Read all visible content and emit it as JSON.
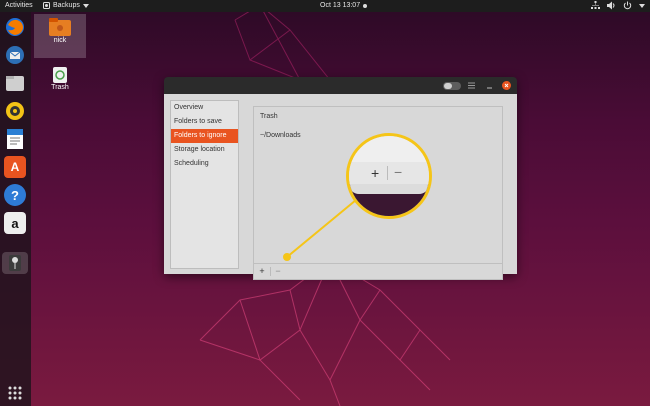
{
  "topbar": {
    "activities": "Activities",
    "app_name": "Backups",
    "clock": "Oct 13  13:07",
    "tray_icons": [
      "network-icon",
      "volume-icon",
      "power-icon"
    ]
  },
  "desktop": {
    "home_label": "nick",
    "trash_label": "Trash"
  },
  "dock": {
    "items": [
      "firefox-icon",
      "thunderbird-icon",
      "files-icon",
      "rhythmbox-icon",
      "libreoffice-writer-icon",
      "software-icon",
      "help-icon",
      "amazon-icon",
      "backups-icon"
    ],
    "help_glyph": "?",
    "amazon_glyph": "a",
    "software_glyph": "A"
  },
  "window": {
    "sidebar": [
      "Overview",
      "Folders to save",
      "Folders to ignore",
      "Storage location",
      "Scheduling"
    ],
    "selected_index": 2,
    "folders": [
      "Trash",
      "~/Downloads"
    ],
    "add_label": "+",
    "remove_label": "−"
  },
  "zoom": {
    "add_label": "+",
    "remove_label": "−"
  },
  "colors": {
    "accent": "#e95420",
    "callout": "#f5c518"
  }
}
